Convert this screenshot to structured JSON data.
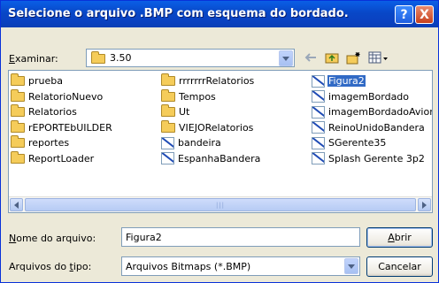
{
  "window": {
    "title": "Selecione o arquivo .BMP com esquema do bordado.",
    "help_label": "?",
    "close_label": "X"
  },
  "lookin": {
    "label_key": "E",
    "label_rest": "xaminar:",
    "value": "3.50"
  },
  "files": [
    {
      "name": "prueba",
      "type": "folder",
      "selected": false
    },
    {
      "name": "RelatorioNuevo",
      "type": "folder",
      "selected": false
    },
    {
      "name": "Relatorios",
      "type": "folder",
      "selected": false
    },
    {
      "name": "rEPORTEbUILDER",
      "type": "folder",
      "selected": false
    },
    {
      "name": "reportes",
      "type": "folder",
      "selected": false
    },
    {
      "name": "ReportLoader",
      "type": "folder",
      "selected": false
    },
    {
      "name": "rrrrrrrRelatorios",
      "type": "folder",
      "selected": false
    },
    {
      "name": "Tempos",
      "type": "folder",
      "selected": false
    },
    {
      "name": "Ut",
      "type": "folder",
      "selected": false
    },
    {
      "name": "VIEJORelatorios",
      "type": "folder",
      "selected": false
    },
    {
      "name": "bandeira",
      "type": "bmp",
      "selected": false
    },
    {
      "name": "EspanhaBandera",
      "type": "bmp",
      "selected": false
    },
    {
      "name": "Figura2",
      "type": "bmp",
      "selected": true
    },
    {
      "name": "imagemBordado",
      "type": "bmp",
      "selected": false
    },
    {
      "name": "imagemBordadoAvion",
      "type": "bmp",
      "selected": false
    },
    {
      "name": "ReinoUnidoBandera",
      "type": "bmp",
      "selected": false
    },
    {
      "name": "SGerente35",
      "type": "bmp",
      "selected": false
    },
    {
      "name": "Splash Gerente 3p2",
      "type": "bmp",
      "selected": false
    }
  ],
  "filename": {
    "label_key": "N",
    "label_rest": "ome do arquivo:",
    "value": "Figura2"
  },
  "filetype": {
    "label_pre": "Arquivos do ",
    "label_key": "t",
    "label_rest": "ipo:",
    "value": "Arquivos Bitmaps (*.BMP)"
  },
  "open_button": {
    "key": "A",
    "rest": "brir"
  },
  "cancel_label": "Cancelar",
  "scroll_grip": "|||"
}
